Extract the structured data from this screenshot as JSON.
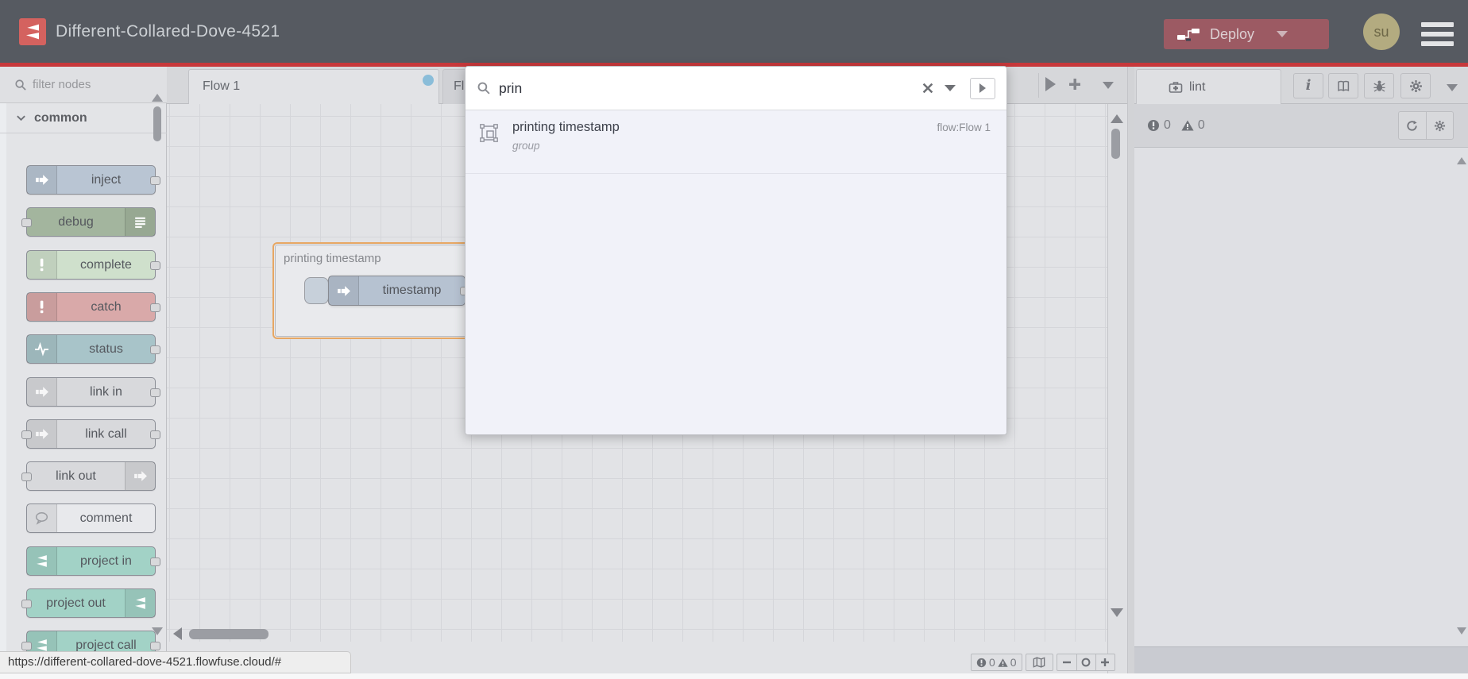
{
  "colors": {
    "brand_red": "#c7383b",
    "header_bg": "#565a61",
    "deploy_bg": "#9c5a63",
    "avatar_bg": "#b3ab80",
    "group_border": "#e7a763",
    "unsaved_dot": "#8abdd9"
  },
  "header": {
    "title": "Different-Collared-Dove-4521",
    "deploy_label": "Deploy",
    "avatar_text": "su"
  },
  "palette": {
    "filter_placeholder": "filter nodes",
    "category_label": "common",
    "nodes": [
      {
        "label": "inject",
        "color": "#b9c5d3",
        "icon": "inject-arrow",
        "icon_side": "left",
        "ports": [
          "right"
        ]
      },
      {
        "label": "debug",
        "color": "#a3b59e",
        "icon": "debug-list",
        "icon_side": "right",
        "ports": [
          "left"
        ]
      },
      {
        "label": "complete",
        "color": "#cfe0cc",
        "icon": "exclamation",
        "icon_side": "left",
        "ports": [
          "right"
        ]
      },
      {
        "label": "catch",
        "color": "#d9a9a9",
        "icon": "exclamation",
        "icon_side": "left",
        "ports": [
          "right"
        ]
      },
      {
        "label": "status",
        "color": "#a8c4c9",
        "icon": "pulse",
        "icon_side": "left",
        "ports": [
          "right"
        ]
      },
      {
        "label": "link in",
        "color": "#d8d9dc",
        "icon": "link-arrow",
        "icon_side": "left",
        "ports": [
          "right"
        ]
      },
      {
        "label": "link call",
        "color": "#d8d9dc",
        "icon": "link-arrow",
        "icon_side": "left",
        "ports": [
          "left",
          "right"
        ]
      },
      {
        "label": "link out",
        "color": "#d8d9dc",
        "icon": "link-arrow",
        "icon_side": "right",
        "ports": [
          "left"
        ]
      },
      {
        "label": "comment",
        "color": "#e8e9ec",
        "icon": "comment-bubble",
        "icon_side": "left",
        "ports": []
      },
      {
        "label": "project in",
        "color": "#a2d2c6",
        "icon": "flowfuse",
        "icon_side": "left",
        "ports": [
          "right"
        ]
      },
      {
        "label": "project out",
        "color": "#a2d2c6",
        "icon": "flowfuse",
        "icon_side": "right",
        "ports": [
          "left"
        ]
      },
      {
        "label": "project call",
        "color": "#a2d2c6",
        "icon": "flowfuse",
        "icon_side": "left",
        "ports": [
          "left",
          "right"
        ]
      }
    ]
  },
  "workspace": {
    "tabs": [
      {
        "label": "Flow 1",
        "active": true,
        "unsaved": true
      },
      {
        "label": "Fl",
        "active": false
      }
    ],
    "group": {
      "label": "printing timestamp",
      "node_label": "timestamp"
    },
    "footer": {
      "error_count": "0",
      "warning_count": "0"
    }
  },
  "search": {
    "query": "prin",
    "results": [
      {
        "icon": "group-box",
        "title": "printing timestamp",
        "subtitle": "group",
        "flow": "flow:Flow 1"
      }
    ]
  },
  "sidebar": {
    "tab_label": "lint",
    "error_count": "0",
    "warning_count": "0"
  },
  "browser": {
    "status_url": "https://different-collared-dove-4521.flowfuse.cloud/#"
  }
}
